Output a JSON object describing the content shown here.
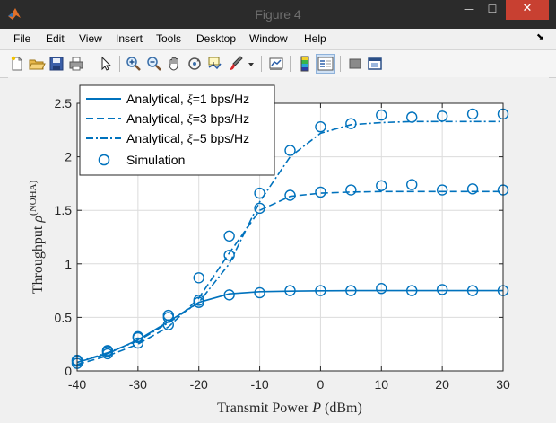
{
  "window": {
    "title": "Figure 4",
    "min_glyph": "—",
    "max_glyph": "☐",
    "close_glyph": "✕"
  },
  "menu": {
    "items": [
      "File",
      "Edit",
      "View",
      "Insert",
      "Tools",
      "Desktop",
      "Window",
      "Help"
    ],
    "dock_arrow": "⬊"
  },
  "toolbar": {
    "icons": [
      "new-figure-icon",
      "open-file-icon",
      "save-icon",
      "print-icon",
      "pointer-icon",
      "zoom-in-icon",
      "zoom-out-icon",
      "pan-icon",
      "rotate-3d-icon",
      "data-cursor-icon",
      "brush-icon",
      "brush-dropdown-icon",
      "link-plot-icon",
      "colorbar-icon",
      "legend-icon",
      "hide-plot-tools-icon",
      "show-plot-tools-icon"
    ]
  },
  "chart_data": {
    "type": "line",
    "xlabel_text": "Transmit Power ",
    "xlabel_var": "P",
    "xlabel_unit": " (dBm)",
    "ylabel_text": "Throughput ",
    "ylabel_var": "ρ",
    "ylabel_sup": "(NOHA)",
    "xlim": [
      -40,
      30
    ],
    "ylim": [
      0,
      2.5
    ],
    "xticks": [
      -40,
      -30,
      -20,
      -10,
      0,
      10,
      20,
      30
    ],
    "xtick_labels": [
      "-40",
      "-30",
      "-20",
      "-10",
      "0",
      "10",
      "20",
      "30"
    ],
    "yticks": [
      0,
      0.5,
      1,
      1.5,
      2,
      2.5
    ],
    "ytick_labels": [
      "0",
      "0.5",
      "1",
      "1.5",
      "2",
      "2.5"
    ],
    "grid": true,
    "legend_position": "top-left",
    "color": "#0072bd",
    "series": [
      {
        "name": "Analytical, ξ=1 bps/Hz",
        "legend_prefix": "Analytical, ",
        "legend_var": "ξ",
        "legend_suffix": "=1 bps/Hz",
        "style": "solid",
        "x": [
          -40,
          -35,
          -30,
          -25,
          -20,
          -15,
          -10,
          -5,
          0,
          5,
          10,
          15,
          20,
          25,
          30
        ],
        "y": [
          0.08,
          0.16,
          0.29,
          0.46,
          0.64,
          0.72,
          0.74,
          0.745,
          0.748,
          0.75,
          0.75,
          0.75,
          0.75,
          0.75,
          0.75
        ]
      },
      {
        "name": "Analytical, ξ=3 bps/Hz",
        "legend_prefix": "Analytical, ",
        "legend_var": "ξ",
        "legend_suffix": "=3 bps/Hz",
        "style": "dashed",
        "x": [
          -40,
          -35,
          -30,
          -25,
          -20,
          -15,
          -10,
          -5,
          0,
          5,
          10,
          15,
          20,
          25,
          30
        ],
        "y": [
          0.06,
          0.14,
          0.25,
          0.41,
          0.68,
          1.1,
          1.5,
          1.63,
          1.66,
          1.67,
          1.675,
          1.675,
          1.675,
          1.675,
          1.675
        ]
      },
      {
        "name": "Analytical, ξ=5 bps/Hz",
        "legend_prefix": "Analytical, ",
        "legend_var": "ξ",
        "legend_suffix": "=5 bps/Hz",
        "style": "dashdot",
        "x": [
          -40,
          -35,
          -30,
          -25,
          -20,
          -15,
          -10,
          -5,
          0,
          5,
          10,
          15,
          20,
          25,
          30
        ],
        "y": [
          0.08,
          0.17,
          0.28,
          0.45,
          0.64,
          1.0,
          1.58,
          2.0,
          2.22,
          2.3,
          2.32,
          2.33,
          2.33,
          2.33,
          2.33
        ]
      },
      {
        "name": "Simulation",
        "style": "markers",
        "points": [
          [
            -40,
            0.1
          ],
          [
            -35,
            0.19
          ],
          [
            -30,
            0.32
          ],
          [
            -25,
            0.52
          ],
          [
            -20,
            0.66
          ],
          [
            -15,
            0.71
          ],
          [
            -10,
            0.73
          ],
          [
            -5,
            0.75
          ],
          [
            0,
            0.75
          ],
          [
            5,
            0.75
          ],
          [
            10,
            0.77
          ],
          [
            15,
            0.75
          ],
          [
            20,
            0.76
          ],
          [
            25,
            0.75
          ],
          [
            30,
            0.75
          ],
          [
            -40,
            0.07
          ],
          [
            -35,
            0.16
          ],
          [
            -30,
            0.26
          ],
          [
            -25,
            0.43
          ],
          [
            -20,
            0.87
          ],
          [
            -15,
            1.08
          ],
          [
            -10,
            1.52
          ],
          [
            -5,
            1.64
          ],
          [
            0,
            1.67
          ],
          [
            5,
            1.69
          ],
          [
            10,
            1.73
          ],
          [
            15,
            1.74
          ],
          [
            20,
            1.69
          ],
          [
            25,
            1.7
          ],
          [
            30,
            1.69
          ],
          [
            -40,
            0.09
          ],
          [
            -35,
            0.18
          ],
          [
            -30,
            0.31
          ],
          [
            -25,
            0.5
          ],
          [
            -20,
            0.64
          ],
          [
            -15,
            1.26
          ],
          [
            -10,
            1.66
          ],
          [
            -5,
            2.06
          ],
          [
            0,
            2.28
          ],
          [
            5,
            2.31
          ],
          [
            10,
            2.39
          ],
          [
            15,
            2.37
          ],
          [
            20,
            2.38
          ],
          [
            25,
            2.4
          ],
          [
            30,
            2.4
          ]
        ]
      }
    ]
  }
}
